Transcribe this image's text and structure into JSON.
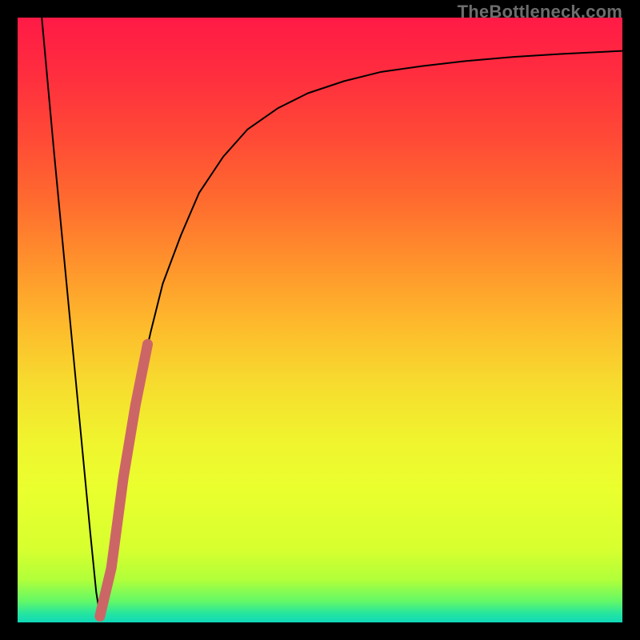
{
  "watermark": {
    "text": "TheBottleneck.com"
  },
  "gradient": {
    "stops": [
      {
        "offset": 0.0,
        "color": "#ff1a46"
      },
      {
        "offset": 0.1,
        "color": "#ff2f3e"
      },
      {
        "offset": 0.2,
        "color": "#ff4a36"
      },
      {
        "offset": 0.3,
        "color": "#ff6a2f"
      },
      {
        "offset": 0.4,
        "color": "#ff902c"
      },
      {
        "offset": 0.5,
        "color": "#feb72c"
      },
      {
        "offset": 0.6,
        "color": "#f7da2e"
      },
      {
        "offset": 0.7,
        "color": "#f0f42e"
      },
      {
        "offset": 0.78,
        "color": "#eaff2e"
      },
      {
        "offset": 0.88,
        "color": "#d7ff2f"
      },
      {
        "offset": 0.93,
        "color": "#b0ff3a"
      },
      {
        "offset": 0.965,
        "color": "#63f867"
      },
      {
        "offset": 0.985,
        "color": "#26e59f"
      },
      {
        "offset": 1.0,
        "color": "#0fd9b8"
      }
    ]
  },
  "chart_data": {
    "type": "line",
    "title": "",
    "xlabel": "",
    "ylabel": "",
    "xlim": [
      0,
      100
    ],
    "ylim": [
      0,
      100
    ],
    "grid": false,
    "legend": false,
    "series": [
      {
        "name": "bottleneck-curve",
        "color": "#000000",
        "stroke_width": 2,
        "x": [
          4.0,
          6.0,
          8.0,
          10.0,
          12.0,
          13.0,
          13.6,
          14.2,
          15.0,
          16.0,
          17.0,
          18.0,
          20.0,
          22.0,
          24.0,
          27.0,
          30.0,
          34.0,
          38.0,
          43.0,
          48.0,
          54.0,
          60.0,
          67.0,
          74.0,
          82.0,
          90.0,
          100.0
        ],
        "values": [
          100.0,
          78.0,
          57.0,
          36.0,
          15.0,
          5.0,
          1.2,
          1.0,
          5.0,
          13.0,
          20.0,
          27.0,
          39.0,
          48.0,
          56.0,
          64.0,
          71.0,
          77.0,
          81.5,
          85.0,
          87.5,
          89.5,
          91.0,
          92.0,
          92.8,
          93.5,
          94.0,
          94.5
        ]
      },
      {
        "name": "highlight-sweet-spot",
        "color": "#cc6666",
        "stroke_width": 13,
        "linecap": "round",
        "x": [
          13.6,
          15.5,
          17.5,
          19.5,
          21.5
        ],
        "values": [
          1.0,
          9.0,
          24.0,
          36.0,
          46.0
        ]
      }
    ]
  }
}
